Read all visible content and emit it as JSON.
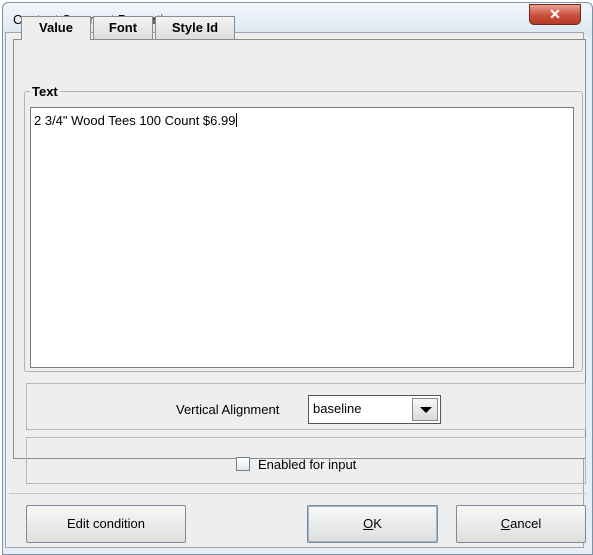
{
  "window": {
    "title": "Content Segment Properties",
    "close_glyph": "✕"
  },
  "tabs": [
    {
      "label": "Value",
      "active": true
    },
    {
      "label": "Font",
      "active": false
    },
    {
      "label": "Style Id",
      "active": false
    }
  ],
  "text_section": {
    "legend": "Text",
    "value": "2 3/4\" Wood Tees 100 Count $6.99"
  },
  "vertical_alignment": {
    "label": "Vertical Alignment",
    "selected": "baseline"
  },
  "enabled_for_input": {
    "label": "Enabled for input",
    "checked": false
  },
  "buttons": {
    "edit_condition": "Edit condition",
    "ok_mnemonic": "O",
    "ok_rest": "K",
    "cancel_mnemonic": "C",
    "cancel_rest": "ancel"
  }
}
